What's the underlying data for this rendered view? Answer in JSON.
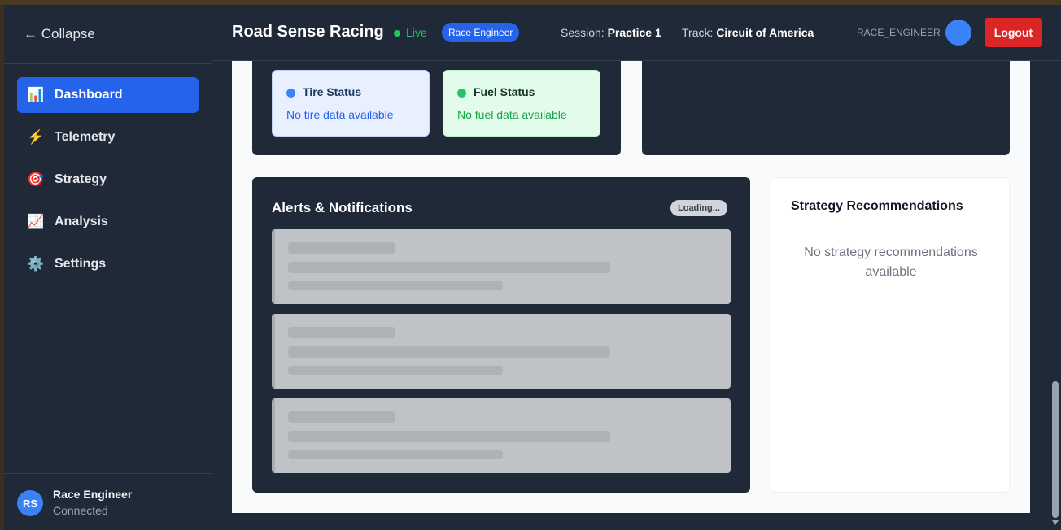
{
  "sidebar": {
    "collapse_label": "← Collapse",
    "items": [
      {
        "icon": "📊",
        "label": "Dashboard",
        "active": true
      },
      {
        "icon": "⚡",
        "label": "Telemetry"
      },
      {
        "icon": "🎯",
        "label": "Strategy"
      },
      {
        "icon": "📈",
        "label": "Analysis"
      },
      {
        "icon": "⚙️",
        "label": "Settings"
      }
    ],
    "user": {
      "initials": "RS",
      "name": "Race Engineer",
      "status": "Connected"
    }
  },
  "header": {
    "title": "Road Sense Racing",
    "live": "Live",
    "role_badge": "Race Engineer",
    "session_label": "Session:",
    "session_value": "Practice 1",
    "track_label": "Track:",
    "track_value": "Circuit of America",
    "username": "RACE_ENGINEER",
    "logout": "Logout"
  },
  "status_cards": {
    "tire": {
      "title": "Tire Status",
      "message": "No tire data available"
    },
    "fuel": {
      "title": "Fuel Status",
      "message": "No fuel data available"
    }
  },
  "alerts": {
    "title": "Alerts & Notifications",
    "badge": "Loading..."
  },
  "strategy": {
    "title": "Strategy Recommendations",
    "empty": "No strategy recommendations available"
  },
  "colors": {
    "accent": "#2563eb",
    "live": "#22c55e",
    "logout": "#dc2626",
    "sidebar_bg": "#1f2937"
  }
}
